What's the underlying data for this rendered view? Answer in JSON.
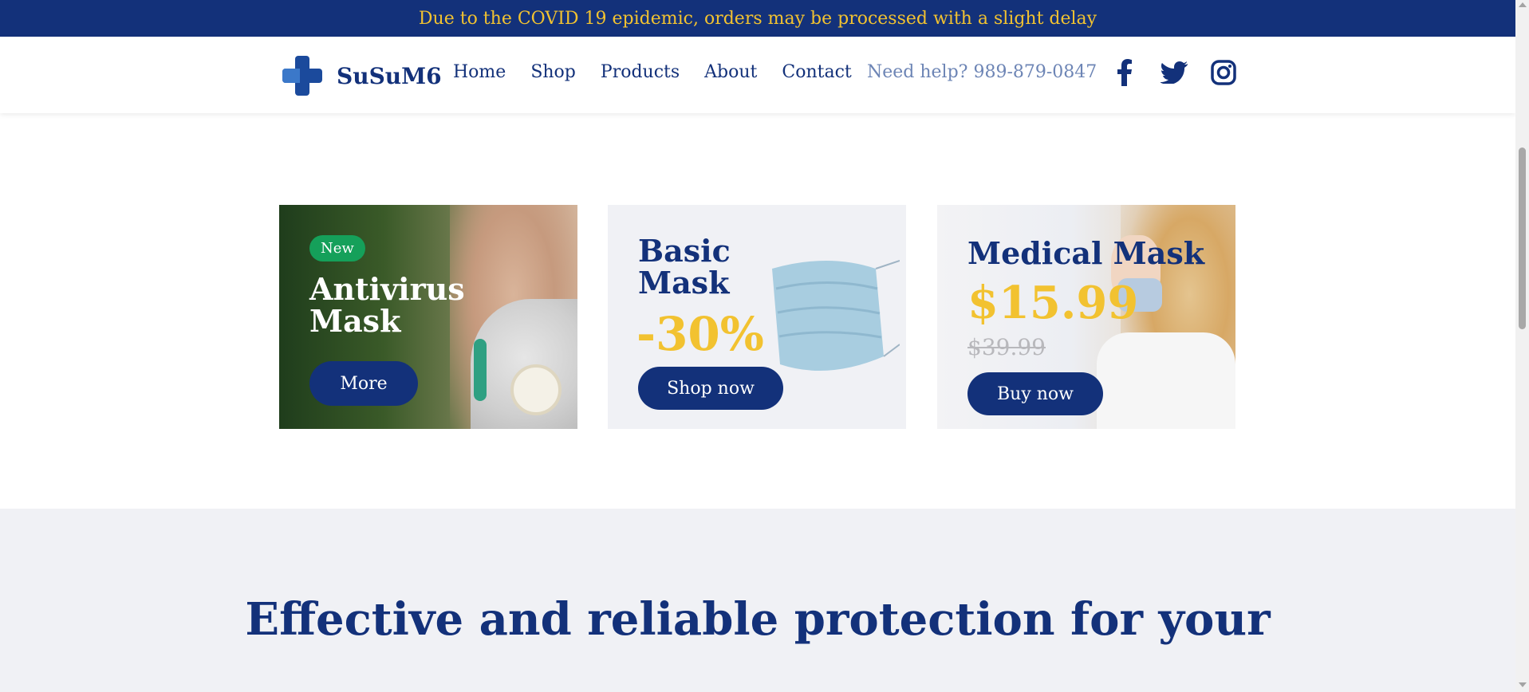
{
  "announcement": {
    "text": "Due to the COVID 19 epidemic, orders may be processed with a slight delay"
  },
  "header": {
    "brand": "SuSuM6",
    "nav": [
      {
        "label": "Home"
      },
      {
        "label": "Shop"
      },
      {
        "label": "Products"
      },
      {
        "label": "About"
      },
      {
        "label": "Contact"
      }
    ],
    "help": "Need help? 989-879-0847",
    "social": [
      "facebook-icon",
      "twitter-icon",
      "instagram-icon"
    ]
  },
  "promos": [
    {
      "badge": "New",
      "title": "Antivirus Mask",
      "button": "More"
    },
    {
      "title": "Basic Mask",
      "discount": "-30%",
      "button": "Shop now"
    },
    {
      "title": "Medical Mask",
      "price": "$15.99",
      "old_price": "$39.99",
      "button": "Buy now"
    }
  ],
  "section": {
    "heading": "Effective and reliable protection for your"
  },
  "colors": {
    "primary": "#13317a",
    "accent": "#f2c230",
    "badge": "#15a05a",
    "section_bg": "#f0f1f5"
  }
}
